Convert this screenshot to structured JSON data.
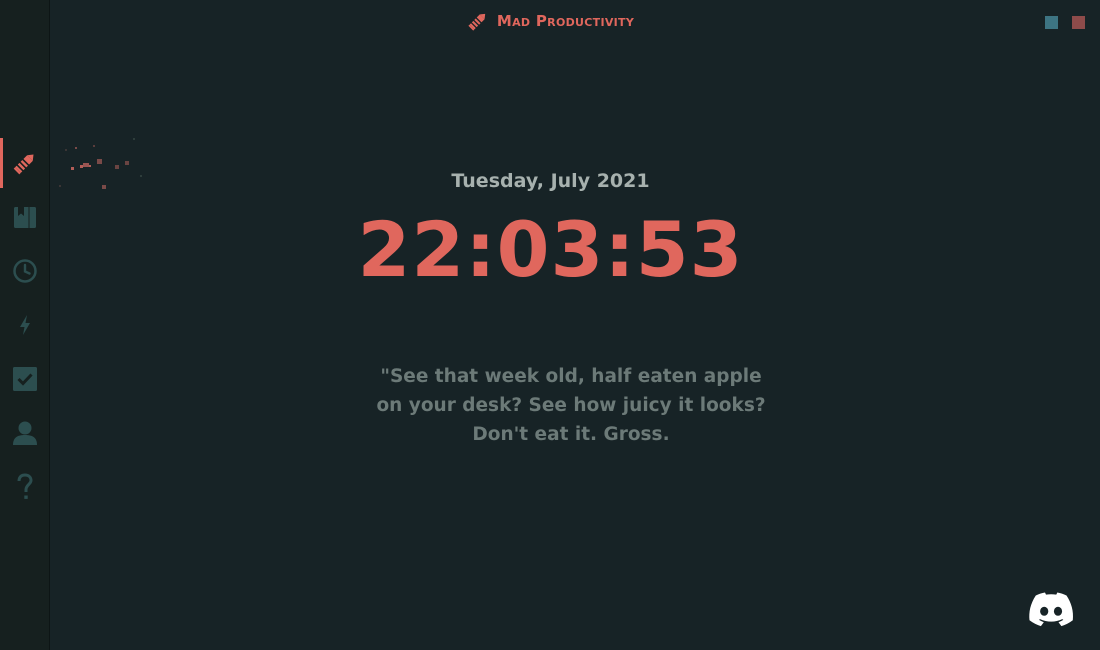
{
  "header": {
    "app_title": "Mad Productivity",
    "brand_icon": "pencil-icon"
  },
  "theme_swatches": [
    {
      "name": "teal",
      "color": "#3d7482"
    },
    {
      "name": "coral",
      "color": "#8e4b4a"
    }
  ],
  "sidebar": {
    "items": [
      {
        "id": "home",
        "icon": "pencil-icon",
        "active": true
      },
      {
        "id": "notes",
        "icon": "notebook-icon",
        "active": false
      },
      {
        "id": "timer",
        "icon": "clock-icon",
        "active": false
      },
      {
        "id": "focus",
        "icon": "lightning-icon",
        "active": false
      },
      {
        "id": "tasks",
        "icon": "checkbox-icon",
        "active": false
      },
      {
        "id": "profile",
        "icon": "user-icon",
        "active": false
      },
      {
        "id": "help",
        "icon": "question-icon",
        "active": false
      }
    ]
  },
  "main": {
    "date": "Tuesday, July 2021",
    "time": "22:03:53",
    "quote": "\"See that week old, half eaten apple on your desk? See how juicy it looks? Don't eat it. Gross."
  },
  "footer": {
    "discord_icon": "discord-icon"
  },
  "colors": {
    "background": "#172326",
    "sidebar": "#16201f",
    "accent": "#e0675d",
    "icon_muted": "#2c4e4f",
    "date_text": "#a7b1ae",
    "quote_text": "#6c7a78"
  }
}
